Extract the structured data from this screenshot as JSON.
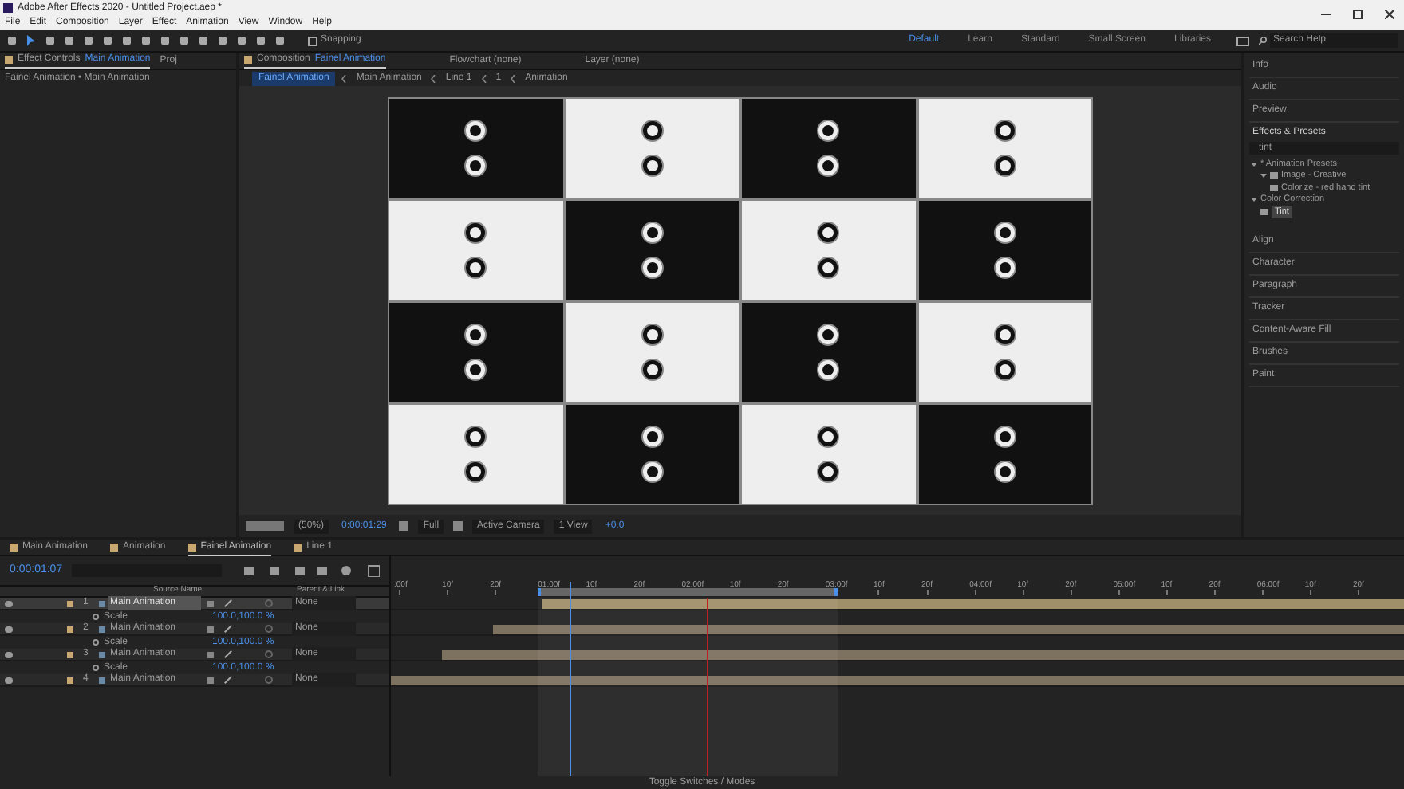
{
  "window": {
    "title": "Adobe After Effects 2020 - Untitled Project.aep *"
  },
  "menu": [
    "File",
    "Edit",
    "Composition",
    "Layer",
    "Effect",
    "Animation",
    "View",
    "Window",
    "Help"
  ],
  "toolbar": {
    "snapping": {
      "label": "Snapping",
      "checked": false
    }
  },
  "workspaces": [
    {
      "label": "Default",
      "selected": true
    },
    {
      "label": "Learn",
      "selected": false
    },
    {
      "label": "Standard",
      "selected": false
    },
    {
      "label": "Small Screen",
      "selected": false
    },
    {
      "label": "Libraries",
      "selected": false
    }
  ],
  "search_help": {
    "placeholder": "Search Help"
  },
  "effect_controls": {
    "tabs": [
      {
        "label": "Effect Controls",
        "target": "Main Animation",
        "selected": true
      },
      {
        "label": "Proj",
        "selected": false
      }
    ],
    "path": "Fainel Animation • Main Animation"
  },
  "composition": {
    "tabs": [
      {
        "label": "Composition",
        "target": "Fainel Animation",
        "selected": true
      },
      {
        "label": "Flowchart (none)",
        "selected": false
      },
      {
        "label": "Layer (none)",
        "selected": false
      }
    ],
    "breadcrumbs": [
      {
        "label": "Fainel Animation",
        "selected": true
      },
      {
        "label": "Main Animation",
        "selected": false
      },
      {
        "label": "Line 1",
        "selected": false
      },
      {
        "label": "1",
        "selected": false
      },
      {
        "label": "Animation",
        "selected": false
      }
    ],
    "tiles": [
      {
        "kind": "dark"
      },
      {
        "kind": "light"
      },
      {
        "kind": "dark"
      },
      {
        "kind": "light"
      },
      {
        "kind": "light"
      },
      {
        "kind": "dark"
      },
      {
        "kind": "light"
      },
      {
        "kind": "dark"
      },
      {
        "kind": "dark"
      },
      {
        "kind": "light"
      },
      {
        "kind": "dark"
      },
      {
        "kind": "light"
      },
      {
        "kind": "light"
      },
      {
        "kind": "dark"
      },
      {
        "kind": "light"
      },
      {
        "kind": "dark"
      }
    ],
    "viewer_bar": {
      "zoom": "(50%)",
      "timecode": "0:00:01:29",
      "resolution": "Full",
      "camera": "Active Camera",
      "views": "1 View",
      "exposure": "+0.0"
    }
  },
  "panels": [
    {
      "kind": "header",
      "label": "Info"
    },
    {
      "kind": "header",
      "label": "Audio"
    },
    {
      "kind": "header",
      "label": "Preview"
    },
    {
      "kind": "effects",
      "label": "Effects & Presets",
      "search": "tint",
      "tree": [
        {
          "label": "* Animation Presets",
          "expanded": true,
          "children": [
            {
              "label": "Image - Creative",
              "expanded": true,
              "children": [
                {
                  "label": "Colorize - red hand tint"
                }
              ]
            }
          ]
        },
        {
          "label": "Color Correction",
          "expanded": true,
          "children": [
            {
              "label": "Tint",
              "selected": true
            }
          ]
        }
      ]
    },
    {
      "kind": "header",
      "label": "Align"
    },
    {
      "kind": "header",
      "label": "Character"
    },
    {
      "kind": "header",
      "label": "Paragraph"
    },
    {
      "kind": "header",
      "label": "Tracker"
    },
    {
      "kind": "header",
      "label": "Content-Aware Fill"
    },
    {
      "kind": "header",
      "label": "Brushes"
    },
    {
      "kind": "header",
      "label": "Paint"
    }
  ],
  "timeline": {
    "tabs": [
      {
        "label": "Main Animation",
        "selected": false
      },
      {
        "label": "Animation",
        "selected": false
      },
      {
        "label": "Fainel Animation",
        "selected": true
      },
      {
        "label": "Line 1",
        "selected": false
      }
    ],
    "timecode": "0:00:01:07",
    "columns": [
      "Source Name",
      "Parent & Link"
    ],
    "ruler": [
      ":00f",
      "10f",
      "20f",
      "01:00f",
      "10f",
      "20f",
      "02:00f",
      "10f",
      "20f",
      "03:00f",
      "10f",
      "20f",
      "04:00f",
      "10f",
      "20f",
      "05:00f",
      "10f",
      "20f",
      "06:00f",
      "10f",
      "20f"
    ],
    "layers": [
      {
        "number": "1",
        "name": "Main Animation",
        "parent": "None",
        "selected": true,
        "property": "Scale",
        "value": "100.0,100.0 %",
        "level": 0.85
      },
      {
        "number": "2",
        "name": "Main Animation",
        "parent": "None",
        "selected": false,
        "property": "Scale",
        "value": "100.0,100.0 %",
        "level": 0.9
      },
      {
        "number": "3",
        "name": "Main Animation",
        "parent": "None",
        "selected": false,
        "property": "Scale",
        "value": "100.0,100.0 %",
        "level": 0.95
      },
      {
        "number": "4",
        "name": "Main Animation",
        "parent": "None",
        "selected": false,
        "level": 1
      }
    ],
    "toggle": "Toggle Switches / Modes"
  }
}
